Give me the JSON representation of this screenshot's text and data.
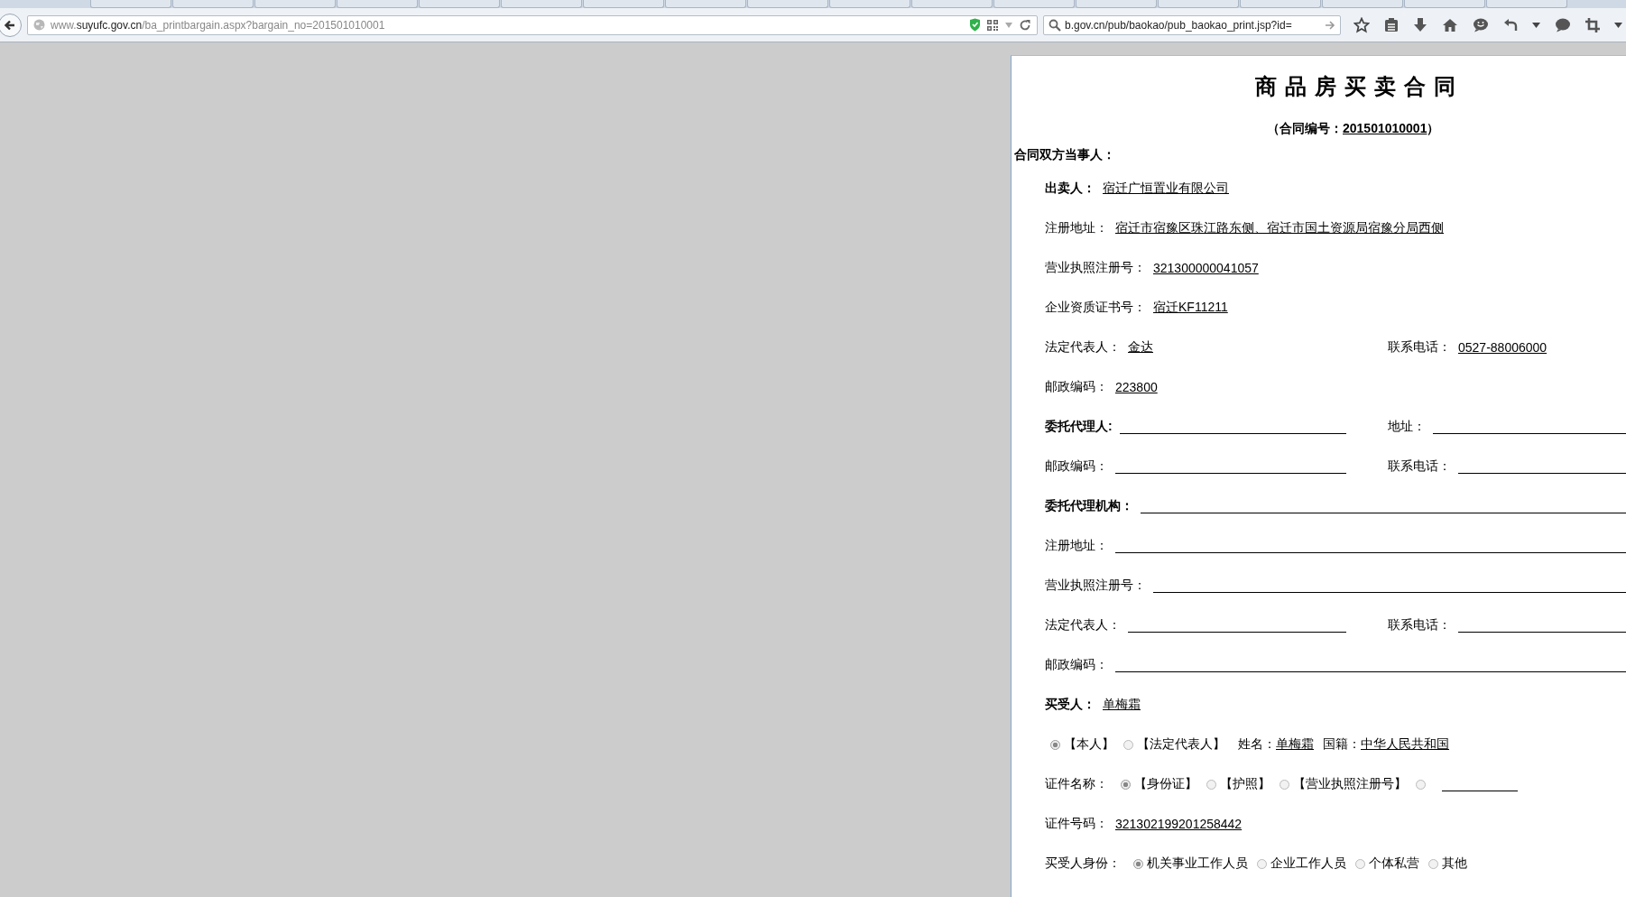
{
  "address_bar": {
    "url": {
      "prefix": "www.",
      "domain": "suyufc.gov.cn",
      "path": "/ba_printbargain.aspx?bargain_no=201501010001"
    },
    "search": {
      "value": "b.gov.cn/pub/baokao/pub_baokao_print.jsp?id="
    }
  },
  "document": {
    "title": "商品房买卖合同",
    "contract_number": {
      "prefix": "（合同编号：",
      "value": "201501010001",
      "suffix": "）"
    },
    "parties_heading": "合同双方当事人：",
    "rows": [
      {
        "kind": "field",
        "label": "出卖人：",
        "bold": true,
        "value": "宿迁广恒置业有限公司"
      },
      {
        "kind": "field",
        "label": "注册地址：",
        "bold": false,
        "value": "宿迁市宿豫区珠江路东侧、宿迁市国土资源局宿豫分局西侧"
      },
      {
        "kind": "field",
        "label": "营业执照注册号：",
        "bold": false,
        "value": "321300000041057"
      },
      {
        "kind": "field",
        "label": "企业资质证书号：",
        "bold": false,
        "value": "宿迁KF11211"
      },
      {
        "kind": "pair",
        "left": {
          "label": "法定代表人：",
          "bold": false,
          "value": "金达"
        },
        "right": {
          "label": "联系电话：",
          "bold": false,
          "value": "0527-88006000"
        }
      },
      {
        "kind": "field",
        "label": "邮政编码：",
        "bold": false,
        "value": "223800"
      },
      {
        "kind": "pair",
        "left": {
          "label": "委托代理人:",
          "bold": true
        },
        "right": {
          "label": "地址：",
          "bold": false
        }
      },
      {
        "kind": "pair",
        "left": {
          "label": "邮政编码：",
          "bold": false
        },
        "right": {
          "label": "联系电话：",
          "bold": false
        }
      },
      {
        "kind": "field",
        "label": "委托代理机构：",
        "bold": true
      },
      {
        "kind": "field",
        "label": "注册地址：",
        "bold": false
      },
      {
        "kind": "field",
        "label": "营业执照注册号：",
        "bold": false
      },
      {
        "kind": "pair",
        "left": {
          "label": "法定代表人：",
          "bold": false
        },
        "right": {
          "label": "联系电话：",
          "bold": false
        }
      },
      {
        "kind": "field",
        "label": "邮政编码：",
        "bold": false
      },
      {
        "kind": "field",
        "label": "买受人：",
        "bold": true,
        "value": "单梅霜"
      },
      {
        "kind": "choice",
        "options": [
          {
            "label": "【本人】",
            "selected": true
          },
          {
            "label": "【法定代表人】",
            "selected": false
          }
        ],
        "fields": [
          {
            "label": "姓名：",
            "value": "单梅霜"
          },
          {
            "label": "国籍：",
            "value": "中华人民共和国"
          }
        ]
      },
      {
        "kind": "choice",
        "label": "证件名称：",
        "options": [
          {
            "label": "【身份证】",
            "selected": true
          },
          {
            "label": "【护照】",
            "selected": false
          },
          {
            "label": "【营业执照注册号】",
            "selected": false
          },
          {
            "blank": true,
            "selected": false
          }
        ]
      },
      {
        "kind": "field",
        "label": "证件号码：",
        "bold": false,
        "value": "321302199201258442"
      },
      {
        "kind": "choice",
        "label": "买受人身份：",
        "options": [
          {
            "label": "机关事业工作人员",
            "selected": true
          },
          {
            "label": "企业工作人员",
            "selected": false
          },
          {
            "label": "个体私营",
            "selected": false
          },
          {
            "label": "其他",
            "selected": false
          }
        ]
      }
    ]
  }
}
